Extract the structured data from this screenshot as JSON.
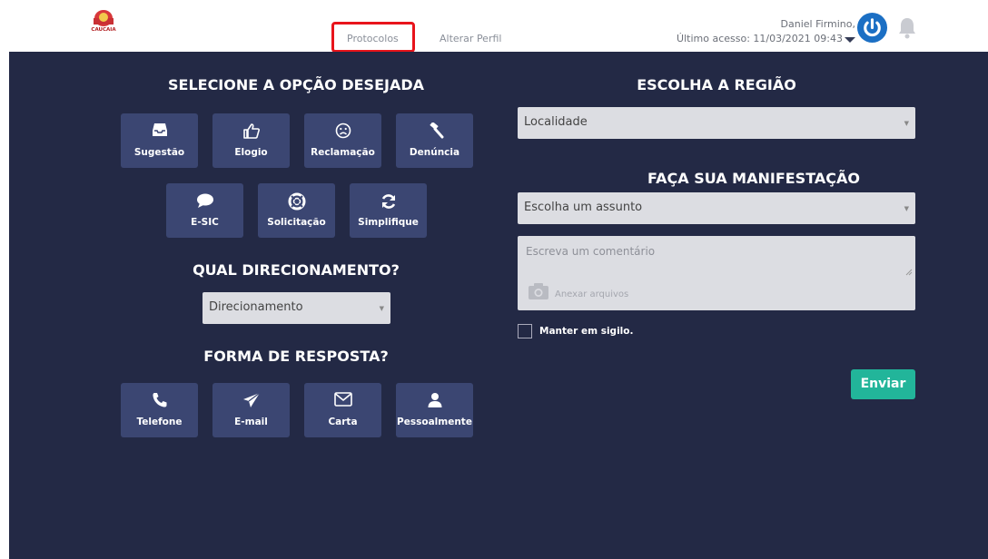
{
  "header": {
    "logo_text": "CAUCAIA",
    "nav": {
      "protocolos": "Protocolos",
      "alterar_perfil": "Alterar Perfil"
    },
    "user": {
      "name": "Daniel Firmino,",
      "last_access": "Último acesso: 11/03/2021 09:43"
    }
  },
  "left": {
    "title_option": "SELECIONE A OPÇÃO DESEJADA",
    "options": [
      "Sugestão",
      "Elogio",
      "Reclamação",
      "Denúncia",
      "E-SIC",
      "Solicitação",
      "Simplifique"
    ],
    "title_direction": "QUAL DIRECIONAMENTO?",
    "direction_select": "Direcionamento",
    "title_response": "FORMA DE RESPOSTA?",
    "responses": [
      "Telefone",
      "E-mail",
      "Carta",
      "Pessoalmente"
    ]
  },
  "right": {
    "title_region": "ESCOLHA A REGIÃO",
    "region_select": "Localidade",
    "title_manifest": "FAÇA SUA MANIFESTAÇÃO",
    "subject_select": "Escolha um assunto",
    "comment_placeholder": "Escreva um comentário",
    "attach_label": "Anexar arquivos",
    "secret_label": "Manter em sigilo.",
    "send_label": "Enviar"
  },
  "colors": {
    "background": "#232945",
    "tile": "#3b4672",
    "send": "#22b59a",
    "highlight": "#e8141b",
    "power": "#1b6fc4"
  }
}
